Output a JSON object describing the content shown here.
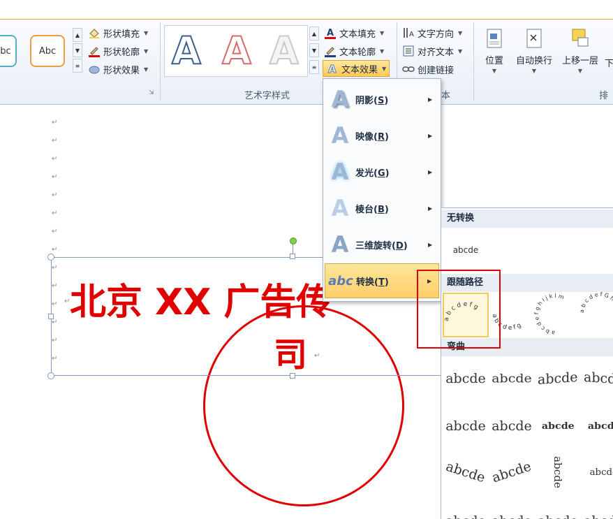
{
  "ribbon": {
    "shape_styles": {
      "style_button_left": "bc",
      "style_button_right": "Abc",
      "shape_fill": "形状填充",
      "shape_outline": "形状轮廓",
      "shape_effects": "形状效果"
    },
    "wordart_styles": {
      "group_label": "艺术字样式",
      "styles": [
        "A",
        "A",
        "A"
      ],
      "text_fill": "文本填充",
      "text_outline": "文本轮廓",
      "text_effects": "文本效果"
    },
    "text_group": {
      "text_direction": "文字方向",
      "align_text": "对齐文本",
      "create_link": "创建链接",
      "group_label_fragment": "本"
    },
    "arrange": {
      "position": "位置",
      "wrap_text": "自动换行",
      "bring_forward": "上移一层",
      "send_backward_fragment": "下",
      "group_label_fragment": "排"
    }
  },
  "document": {
    "title_line1": "北京 XX 广告传",
    "title_line2": "司",
    "para_mark": "↵"
  },
  "text_effects_menu": {
    "items": [
      {
        "label": "阴影",
        "key": "S"
      },
      {
        "label": "映像",
        "key": "R"
      },
      {
        "label": "发光",
        "key": "G"
      },
      {
        "label": "棱台",
        "key": "B"
      },
      {
        "label": "三维旋转",
        "key": "D"
      },
      {
        "label": "转换",
        "key": "T"
      }
    ],
    "highlighted": "转换"
  },
  "transform_gallery": {
    "sections": {
      "no_transform": "无转换",
      "follow_path": "跟随路径",
      "warp": "弯曲"
    },
    "no_transform_sample": "abcde",
    "warp_sample": "abcde",
    "path_samples": [
      "a b c d e f g",
      "a b c d e f g",
      "a b c d e f g h i j k l m",
      "a b c d e f G h i j k l m n o"
    ]
  },
  "colors": {
    "accent_red": "#e00000",
    "highlight": "#ffcf6a",
    "ribbon_bg": "#e9eff7"
  }
}
